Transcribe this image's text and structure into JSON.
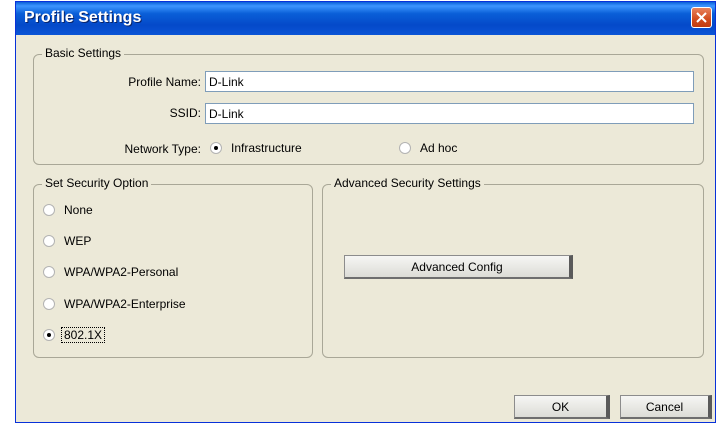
{
  "window": {
    "title": "Profile Settings"
  },
  "basic_settings": {
    "legend": "Basic Settings",
    "profile_name_label": "Profile Name:",
    "profile_name_value": "D-Link",
    "ssid_label": "SSID:",
    "ssid_value": "D-Link",
    "network_type_label": "Network Type:",
    "network_types": [
      {
        "label": "Infrastructure",
        "selected": true
      },
      {
        "label": "Ad hoc",
        "selected": false
      }
    ]
  },
  "security": {
    "legend": "Set Security Option",
    "options": [
      {
        "label": "None",
        "selected": false
      },
      {
        "label": "WEP",
        "selected": false
      },
      {
        "label": "WPA/WPA2-Personal",
        "selected": false
      },
      {
        "label": "WPA/WPA2-Enterprise",
        "selected": false
      },
      {
        "label": "802.1X",
        "selected": true
      }
    ]
  },
  "advanced": {
    "legend": "Advanced Security Settings",
    "config_button": "Advanced Config"
  },
  "footer": {
    "ok": "OK",
    "cancel": "Cancel"
  },
  "colors": {
    "titlebar": "#0a5fd8",
    "dialog_bg": "#ece9d8",
    "close_button": "#d14b1c"
  }
}
